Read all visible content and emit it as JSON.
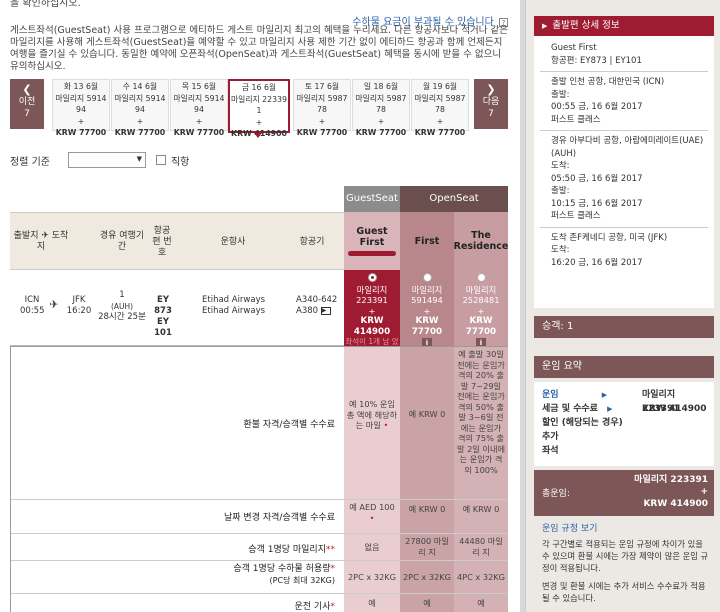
{
  "top_cut_text": "을 확인하십시오.",
  "surcharge_note": "수하물 요금이 부과될 수 있습니다",
  "intro_text": "게스트좌석(GuestSeat) 사용 프로그램으로 에티하드 게스트 마일리지 최고의 혜택을 누리세요. 다른 항공사보다 적거나 같은 마일리지를 사용해 게스트좌석(GuestSeat)을 예약할 수 있고 마일리지 사용 제한 기간 없이 에티하드 항공과 함께 언제든지 여행을 즐기실 수 있습니다. 동일한 예약에 오픈좌석(OpenSeat)과 게스트좌석(GuestSeat) 혜택을 동시에 받을 수 없으니 유의하십시오.",
  "nav": {
    "prev_label": "이전",
    "prev_count": "7",
    "next_label": "다음",
    "next_count": "7"
  },
  "dates": [
    {
      "date": "화 13 6월",
      "miles": "마일리지 5914",
      "num": "94",
      "plus": "+",
      "price": "KRW 77700"
    },
    {
      "date": "수 14 6월",
      "miles": "마일리지 5914",
      "num": "94",
      "plus": "+",
      "price": "KRW 77700"
    },
    {
      "date": "목 15 6월",
      "miles": "마일리지 5914",
      "num": "94",
      "plus": "+",
      "price": "KRW 77700"
    },
    {
      "date": "금 16 6월",
      "miles": "마일리지 22339",
      "num": "1",
      "plus": "+",
      "price": "KRW 414900"
    },
    {
      "date": "토 17 6월",
      "miles": "마일리지 5987",
      "num": "78",
      "plus": "+",
      "price": "KRW 77700"
    },
    {
      "date": "일 18 6월",
      "miles": "마일리지 5987",
      "num": "78",
      "plus": "+",
      "price": "KRW 77700"
    },
    {
      "date": "월 19 6월",
      "miles": "마일리지 5987",
      "num": "78",
      "plus": "+",
      "price": "KRW 77700"
    }
  ],
  "sort": {
    "label": "정렬 기준",
    "direct": "직항"
  },
  "groups": {
    "guest": "GuestSeat",
    "open": "OpenSeat"
  },
  "headers": {
    "dep_arr": "출발지 ✈ 도착지",
    "via": "경유 여행기간",
    "flight_no": "항공 편 번 호",
    "airline": "운항사",
    "aircraft": "항공기",
    "guest_first": "Guest First",
    "first": "First",
    "residence": "The Residence"
  },
  "flight": {
    "from": "ICN",
    "to": "JFK",
    "dep_time": "00:55",
    "arr_time": "16:20",
    "stops": "1",
    "via_code": "(AUH)",
    "duration": "28시간 25분",
    "fn1": "EY 873",
    "fn2": "EY 101",
    "airline1": "Etihad Airways",
    "airline2": "Etihad Airways",
    "ac1": "A340-642",
    "ac2": "A380"
  },
  "fares": {
    "guest_first": {
      "miles": "마일리지 223391",
      "plus": "+",
      "krw": "KRW 414900",
      "note": "좌석이 1개 남 았습니다"
    },
    "first": {
      "miles": "마일리지 591494",
      "plus": "+",
      "krw": "KRW 77700"
    },
    "residence": {
      "miles": "마일리지 2528481",
      "plus": "+",
      "krw": "KRW 77700"
    }
  },
  "rules": {
    "refund_label": "환불 자격/승객별 수수료",
    "refund_gf": "예 10% 운임 총 액에 해당하는 마일",
    "refund_first": "예 KRW 0",
    "refund_res": "예 출발 30일 전에는 운임가 격의 20% 출발 7~29일 전에는 운임가 격의 50% 출발 3~6일 전에는 운임가 격의 75% 출발 2일 이내에는 운임가 격의 100%",
    "change_label": "날짜 변경 자격/승객별 수수료",
    "change_gf": "예 AED 100",
    "change_first": "예 KRW 0",
    "change_res": "예 KRW 0",
    "miles_label": "승객 1명당 마일리지",
    "miles_gf": "없음",
    "miles_first": "27800 마일리 지",
    "miles_res": "44480 마일리 지",
    "bag_label": "승객 1명당 수하물 허용량",
    "bag_sub": "(PC당 최대 32KG)",
    "bag_gf": "2PC x 32KG",
    "bag_first": "2PC x 32KG",
    "bag_res": "4PC x 32KG",
    "chauffeur_label": "운전 기사",
    "chauffeur_gf": "예",
    "chauffeur_first": "예",
    "chauffeur_res": "예"
  },
  "sidebar": {
    "detail_title": "출발편 상세 정보",
    "cabin": "Guest First",
    "flight_label": "항공편: EY873 | EY101",
    "dep_airport": "출발 인천 공항, 대한민국 (ICN)",
    "dep_label": "출발:",
    "dep_time": "00:55 금, 16 6월 2017",
    "dep_class": "퍼스트 클래스",
    "via_airport": "경유 아부다비 공항, 아랍에미레이트(UAE) (AUH)",
    "via_arr_label": "도착:",
    "via_arr": "05:50 금, 16 6월 2017",
    "via_dep_label": "출발:",
    "via_dep": "10:15 금, 16 6월 2017",
    "via_class": "퍼스트 클래스",
    "arr_airport": "도착 존F케네디 공항, 미국 (JFK)",
    "arr_label": "도착:",
    "arr_time": "16:20 금, 16 6월 2017",
    "pax": "승객: 1",
    "fare_summary_title": "운임 요약",
    "fare_label": "운임",
    "fare_value": "마일리지 223391",
    "tax_label": "세금 및 수수료",
    "tax_value": "KRW 414900",
    "discount_label": "할인 (해당되는 경우)",
    "extra_label": "추가",
    "seat_label": "좌석",
    "total_label": "총운임:",
    "total_miles": "마일리지 223391",
    "total_plus": "+",
    "total_krw": "KRW 414900",
    "rules_link": "운임 규정 보기",
    "rules_text1": "각 구간별로 적용되는 운임 규정에 차이가 있을 수 있으며 환불 시에는 가장 제약이 많은 운임 규정이 적용됩니다.",
    "rules_text2": "변경 및 환불 시에는 추가 서비스 수수료가 적용될 수 있습니다."
  },
  "colors": {
    "brand": "#9e1b32",
    "nav_brown": "#7d5757",
    "guest_group": "#8c8c8c",
    "open_group": "#6b4f4f",
    "guest_col": "#d9b4b8",
    "first_col": "#b7878b",
    "res_col": "#c79da1"
  }
}
